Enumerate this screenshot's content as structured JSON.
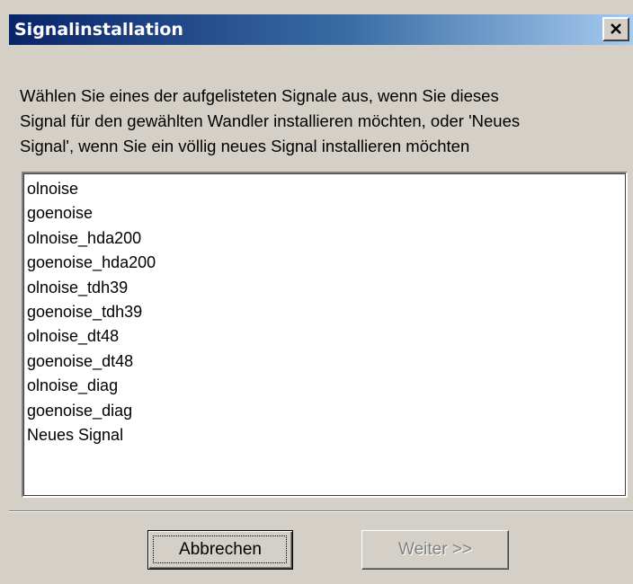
{
  "window": {
    "title": "Signalinstallation",
    "close_icon": "close-icon"
  },
  "description": {
    "lines": [
      "Wählen Sie eines der aufgelisteten Signale aus, wenn Sie dieses",
      "Signal für den gewählten Wandler installieren möchten, oder 'Neues",
      "Signal', wenn Sie ein völlig neues Signal installieren möchten"
    ]
  },
  "signal_list": {
    "items": [
      "olnoise",
      "goenoise",
      "olnoise_hda200",
      "goenoise_hda200",
      "olnoise_tdh39",
      "goenoise_tdh39",
      "olnoise_dt48",
      "goenoise_dt48",
      "olnoise_diag",
      "goenoise_diag",
      "Neues Signal"
    ]
  },
  "buttons": {
    "cancel_label": "Abbrechen",
    "next_label": "Weiter >>",
    "next_enabled": false
  },
  "colors": {
    "title_gradient_start": "#0a246a",
    "title_gradient_end": "#a6caf0",
    "face": "#d4d0c8",
    "disabled_text": "#808080"
  }
}
